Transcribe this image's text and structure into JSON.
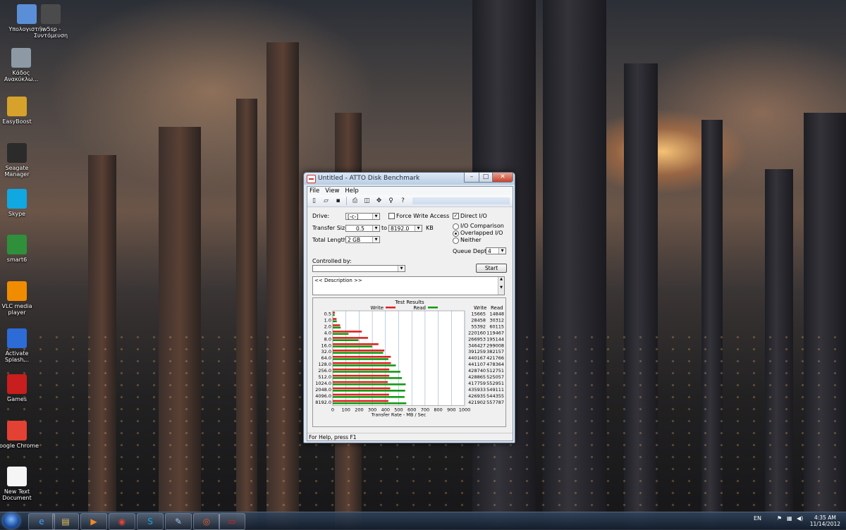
{
  "desktop": {
    "icons": [
      {
        "label": "Υπολογιστής",
        "icon": "computer-icon",
        "color": "#5a8fd8"
      },
      {
        "label": "iw5sp - Συντόμευση",
        "icon": "game-icon",
        "color": "#4b4b4b"
      },
      {
        "label": "Κάδος Ανακύκλω...",
        "icon": "recycle-bin-icon",
        "color": "#8d9aa6"
      },
      {
        "label": "EasyBoost",
        "icon": "easyboost-icon",
        "color": "#d6a22c"
      },
      {
        "label": "Seagate Manager",
        "icon": "seagate-icon",
        "color": "#2b2b2b"
      },
      {
        "label": "Skype",
        "icon": "skype-icon",
        "color": "#11a7e0"
      },
      {
        "label": "smart6",
        "icon": "smart-icon",
        "color": "#2f8f3b"
      },
      {
        "label": "VLC media player",
        "icon": "vlc-icon",
        "color": "#f08c00"
      },
      {
        "label": "Activate Splash...",
        "icon": "splash-icon",
        "color": "#2d6bd6"
      },
      {
        "label": "Games",
        "icon": "games-icon",
        "color": "#c81e1e"
      },
      {
        "label": "Google Chrome",
        "icon": "chrome-icon",
        "color": "#e34133"
      },
      {
        "label": "New Text Document",
        "icon": "text-document-icon",
        "color": "#f5f5f5"
      }
    ]
  },
  "window": {
    "title": "Untitled - ATTO Disk Benchmark",
    "min": "–",
    "max": "□",
    "close": "✕",
    "menu": [
      "File",
      "View",
      "Help"
    ],
    "drive_label": "Drive:",
    "drive_value": "[-c-]",
    "force_write_label": "Force Write Access",
    "force_write_checked": false,
    "direct_io_label": "Direct I/O",
    "direct_io_checked": true,
    "transfer_size_label": "Transfer Size:",
    "transfer_from": "0.5",
    "to_label": "to",
    "transfer_to": "8192.0",
    "kb_label": "KB",
    "total_length_label": "Total Length:",
    "total_length_value": "2 GB",
    "io_comparison_label": "I/O Comparison",
    "overlapped_io_label": "Overlapped I/O",
    "neither_label": "Neither",
    "selected_io_mode": "Overlapped I/O",
    "queue_depth_label": "Queue Depth:",
    "queue_depth_value": "4",
    "controlled_by_label": "Controlled by:",
    "controlled_by_value": "",
    "start_label": "Start",
    "description": "<< Description >>",
    "status": "For Help, press F1"
  },
  "chart_data": {
    "type": "bar",
    "orientation": "horizontal",
    "title": "Test Results",
    "xlabel": "Transfer Rate - MB / Sec",
    "xlim": [
      0,
      1000
    ],
    "xticks": [
      "0",
      "100",
      "200",
      "300",
      "400",
      "500",
      "600",
      "700",
      "800",
      "900",
      "1000"
    ],
    "categories": [
      "0.5",
      "1.0",
      "2.0",
      "4.0",
      "8.0",
      "16.0",
      "32.0",
      "64.0",
      "128.0",
      "256.0",
      "512.0",
      "1024.0",
      "2048.0",
      "4096.0",
      "8192.0"
    ],
    "series": [
      {
        "name": "Write",
        "color": "#e02020",
        "values": [
          15.7,
          28.5,
          55.4,
          220.2,
          267.0,
          346.4,
          391.3,
          440.2,
          441.1,
          428.7,
          428.9,
          417.8,
          435.9,
          426.9,
          421.9
        ]
      },
      {
        "name": "Read",
        "color": "#129a12",
        "values": [
          14.8,
          30.3,
          60.1,
          119.5,
          195.1,
          299.0,
          382.2,
          421.8,
          478.4,
          512.8,
          525.1,
          553.0,
          549.1,
          544.4,
          557.8
        ]
      }
    ],
    "write_header": "Write",
    "read_header": "Read",
    "write_table": [
      "15665",
      "28458",
      "55392",
      "220160",
      "266953",
      "346427",
      "391259",
      "440167",
      "441107",
      "428740",
      "428865",
      "417759",
      "435933",
      "426935",
      "421902"
    ],
    "read_table": [
      "14848",
      "30312",
      "60115",
      "119467",
      "195144",
      "299008",
      "382157",
      "421766",
      "478364",
      "512751",
      "525057",
      "552951",
      "549111",
      "544355",
      "557787"
    ],
    "grid": true,
    "legend_position": "top"
  },
  "taskbar": {
    "buttons": [
      {
        "icon": "internet-explorer-icon",
        "glyph": "e",
        "color": "#3aa0ff"
      },
      {
        "icon": "file-explorer-icon",
        "glyph": "▤",
        "color": "#e8c35a"
      },
      {
        "icon": "media-player-icon",
        "glyph": "▶",
        "color": "#f08a2a"
      },
      {
        "icon": "chrome-icon",
        "glyph": "◉",
        "color": "#e34133"
      },
      {
        "icon": "skype-icon",
        "glyph": "S",
        "color": "#11a7e0"
      },
      {
        "icon": "stylus-icon",
        "glyph": "✎",
        "color": "#9ec8f0"
      },
      {
        "icon": "media-app-icon",
        "glyph": "◎",
        "color": "#f05a28"
      },
      {
        "icon": "atto-icon",
        "glyph": "▭",
        "color": "#e02020"
      }
    ],
    "language": "EN",
    "time": "4:35 AM",
    "date": "11/14/2012"
  }
}
